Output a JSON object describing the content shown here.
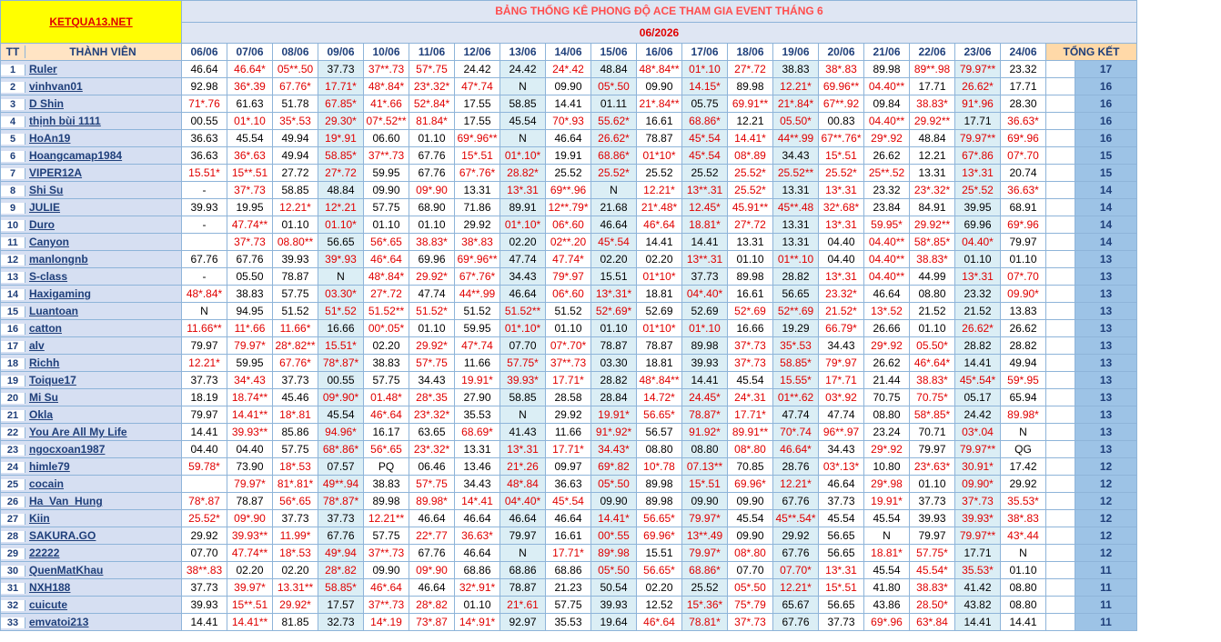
{
  "site_logo": "KETQUA13.NET",
  "table_title": "BẢNG THỐNG KÊ PHONG ĐỘ ACE THAM GIA EVENT THÁNG 6",
  "month": "06/2026",
  "headers": {
    "tt": "TT",
    "member": "THÀNH VIÊN",
    "total": "TỔNG KẾT"
  },
  "dates": [
    "06/06",
    "07/06",
    "08/06",
    "09/06",
    "10/06",
    "11/06",
    "12/06",
    "13/06",
    "14/06",
    "15/06",
    "16/06",
    "17/06",
    "18/06",
    "19/06",
    "20/06",
    "21/06",
    "22/06",
    "23/06",
    "24/06"
  ],
  "rows": [
    {
      "tt": "1",
      "name": "Ruler",
      "total": "17",
      "cells": [
        "46.64",
        "46.64*",
        "05**.50",
        "37.73",
        "37**.73",
        "57*.75",
        "24.42",
        "24.42",
        "24*.42",
        "48.84",
        "48*.84**",
        "01*.10",
        "27*.72",
        "38.83",
        "38*.83",
        "89.98",
        "89**.98",
        "79.97**",
        "23.32"
      ]
    },
    {
      "tt": "2",
      "name": "vinhvan01",
      "total": "16",
      "cells": [
        "92.98",
        "36*.39",
        "67.76*",
        "17.71*",
        "48*.84*",
        "23*.32*",
        "47*.74",
        "N",
        "09.90",
        "05*.50",
        "09.90",
        "14.15*",
        "89.98",
        "12.21*",
        "69.96**",
        "04.40**",
        "17.71",
        "26.62*",
        "17.71"
      ]
    },
    {
      "tt": "3",
      "name": "D Shin",
      "total": "16",
      "cells": [
        "71*.76",
        "61.63",
        "51.78",
        "67.85*",
        "41*.66",
        "52*.84*",
        "17.55",
        "58.85",
        "14.41",
        "01.11",
        "21*.84**",
        "05.75",
        "69.91**",
        "21*.84*",
        "67**.92",
        "09.84",
        "38.83*",
        "91*.96",
        "28.30"
      ]
    },
    {
      "tt": "4",
      "name": "thịnh bùi 1111",
      "total": "16",
      "cells": [
        "00.55",
        "01*.10",
        "35*.53",
        "29.30*",
        "07*.52**",
        "81.84*",
        "17.55",
        "45.54",
        "70*.93",
        "55.62*",
        "16.61",
        "68.86*",
        "12.21",
        "05.50*",
        "00.83",
        "04.40**",
        "29.92**",
        "17.71",
        "36.63*"
      ]
    },
    {
      "tt": "5",
      "name": "HoAn19",
      "total": "16",
      "cells": [
        "36.63",
        "45.54",
        "49.94",
        "19*.91",
        "06.60",
        "01.10",
        "69*.96**",
        "N",
        "46.64",
        "26.62*",
        "78.87",
        "45*.54",
        "14.41*",
        "44**.99",
        "67**.76*",
        "29*.92",
        "48.84",
        "79.97**",
        "69*.96"
      ]
    },
    {
      "tt": "6",
      "name": "Hoangcamap1984",
      "total": "15",
      "cells": [
        "36.63",
        "36*.63",
        "49.94",
        "58.85*",
        "37**.73",
        "67.76",
        "15*.51",
        "01*.10*",
        "19.91",
        "68.86*",
        "01*10*",
        "45*.54",
        "08*.89",
        "34.43",
        "15*.51",
        "26.62",
        "12.21",
        "67*.86",
        "07*.70"
      ]
    },
    {
      "tt": "7",
      "name": "VIPER12A",
      "total": "15",
      "cells": [
        "15.51*",
        "15**.51",
        "27.72",
        "27*.72",
        "59.95",
        "67.76",
        "67*.76*",
        "28.82*",
        "25.52",
        "25.52*",
        "25.52",
        "25.52",
        "25.52*",
        "25.52**",
        "25.52*",
        "25**.52",
        "13.31",
        "13*.31",
        "20.74"
      ]
    },
    {
      "tt": "8",
      "name": "Shi Su",
      "total": "14",
      "cells": [
        "-",
        "37*.73",
        "58.85",
        "48.84",
        "09.90",
        "09*.90",
        "13.31",
        "13*.31",
        "69**.96",
        "N",
        "12.21*",
        "13**.31",
        "25.52*",
        "13.31",
        "13*.31",
        "23.32",
        "23*.32*",
        "25*.52",
        "36.63*"
      ]
    },
    {
      "tt": "9",
      "name": "JULIE",
      "total": "14",
      "cells": [
        "39.93",
        "19.95",
        "12.21*",
        "12*.21",
        "57.75",
        "68.90",
        "71.86",
        "89.91",
        "12**.79*",
        "21.68",
        "21*.48*",
        "12.45*",
        "45.91**",
        "45**.48",
        "32*.68*",
        "23.84",
        "84.91",
        "39.95",
        "68.91"
      ]
    },
    {
      "tt": "10",
      "name": "Duro",
      "total": "14",
      "cells": [
        "-",
        "47.74**",
        "01.10",
        "01.10*",
        "01.10",
        "01.10",
        "29.92",
        "01*.10*",
        "06*.60",
        "46.64",
        "46*.64",
        "18.81*",
        "27*.72",
        "13.31",
        "13*.31",
        "59.95*",
        "29.92**",
        "69.96",
        "69*.96"
      ]
    },
    {
      "tt": "11",
      "name": "Canyon",
      "total": "14",
      "cells": [
        "",
        "37*.73",
        "08.80**",
        "56.65",
        "56*.65",
        "38.83*",
        "38*.83",
        "02.20",
        "02**.20",
        "45*.54",
        "14.41",
        "14.41",
        "13.31",
        "13.31",
        "04.40",
        "04.40**",
        "58*.85*",
        "04.40*",
        "79.97"
      ]
    },
    {
      "tt": "12",
      "name": "manlongnb",
      "total": "13",
      "cells": [
        "67.76",
        "67.76",
        "39.93",
        "39*.93",
        "46*.64",
        "69.96",
        "69*.96**",
        "47.74",
        "47.74*",
        "02.20",
        "02.20",
        "13**.31",
        "01.10",
        "01**.10",
        "04.40",
        "04.40**",
        "38.83*",
        "01.10",
        "01.10"
      ]
    },
    {
      "tt": "13",
      "name": "S-class",
      "total": "13",
      "cells": [
        "-",
        "05.50",
        "78.87",
        "N",
        "48*.84*",
        "29.92*",
        "67*.76*",
        "34.43",
        "79*.97",
        "15.51",
        "01*10*",
        "37.73",
        "89.98",
        "28.82",
        "13*.31",
        "04.40**",
        "44.99",
        "13*.31",
        "07*.70"
      ]
    },
    {
      "tt": "14",
      "name": "Haxigaming",
      "total": "13",
      "cells": [
        "48*.84*",
        "38.83",
        "57.75",
        "03.30*",
        "27*.72",
        "47.74",
        "44**.99",
        "46.64",
        "06*.60",
        "13*.31*",
        "18.81",
        "04*.40*",
        "16.61",
        "56.65",
        "23.32*",
        "46.64",
        "08.80",
        "23.32",
        "09.90*"
      ]
    },
    {
      "tt": "15",
      "name": "Luantoan",
      "total": "13",
      "cells": [
        "N",
        "94.95",
        "51.52",
        "51*.52",
        "51.52**",
        "51.52*",
        "51.52",
        "51.52**",
        "51.52",
        "52*.69*",
        "52.69",
        "52.69",
        "52*.69",
        "52**.69",
        "21.52*",
        "13*.52",
        "21.52",
        "21.52",
        "13.83"
      ]
    },
    {
      "tt": "16",
      "name": "catton",
      "total": "13",
      "cells": [
        "11.66**",
        "11*.66",
        "11.66*",
        "16.66",
        "00*.05*",
        "01.10",
        "59.95",
        "01*.10*",
        "01.10",
        "01.10",
        "01*10*",
        "01*.10",
        "16.66",
        "19.29",
        "66.79*",
        "26.66",
        "01.10",
        "26.62*",
        "26.62"
      ]
    },
    {
      "tt": "17",
      "name": "alv",
      "total": "13",
      "cells": [
        "79.97",
        "79.97*",
        "28*.82**",
        "15.51*",
        "02.20",
        "29.92*",
        "47*.74",
        "07.70",
        "07*.70*",
        "78.87",
        "78.87",
        "89.98",
        "37*.73",
        "35*.53",
        "34.43",
        "29*.92",
        "05.50*",
        "28.82",
        "28.82"
      ]
    },
    {
      "tt": "18",
      "name": "Richh",
      "total": "13",
      "cells": [
        "12.21*",
        "59.95",
        "67.76*",
        "78*.87*",
        "38.83",
        "57*.75",
        "11.66",
        "57.75*",
        "37**.73",
        "03.30",
        "18.81",
        "39.93",
        "37*.73",
        "58.85*",
        "79*.97",
        "26.62",
        "46*.64*",
        "14.41",
        "49.94"
      ]
    },
    {
      "tt": "19",
      "name": "Toique17",
      "total": "13",
      "cells": [
        "37.73",
        "34*.43",
        "37.73",
        "00.55",
        "57.75",
        "34.43",
        "19.91*",
        "39.93*",
        "17.71*",
        "28.82",
        "48*.84**",
        "14.41",
        "45.54",
        "15.55*",
        "17*.71",
        "21.44",
        "38.83*",
        "45*.54*",
        "59*.95"
      ]
    },
    {
      "tt": "20",
      "name": "Mi Su",
      "total": "13",
      "cells": [
        "18.19",
        "18.74**",
        "45.46",
        "09*.90*",
        "01.48*",
        "28*.35",
        "27.90",
        "58.85",
        "28.58",
        "28.84",
        "14.72*",
        "24.45*",
        "24*.31",
        "01**.62",
        "03*.92",
        "70.75",
        "70.75*",
        "05.17",
        "65.94"
      ]
    },
    {
      "tt": "21",
      "name": "Okla",
      "total": "13",
      "cells": [
        "79.97",
        "14.41**",
        "18*.81",
        "45.54",
        "46*.64",
        "23*.32*",
        "35.53",
        "N",
        "29.92",
        "19.91*",
        "56.65*",
        "78.87*",
        "17.71*",
        "47.74",
        "47.74",
        "08.80",
        "58*.85*",
        "24.42",
        "89.98*"
      ]
    },
    {
      "tt": "22",
      "name": "You Are All My Life",
      "total": "13",
      "cells": [
        "14.41",
        "39.93**",
        "85.86",
        "94.96*",
        "16.17",
        "63.65",
        "68.69*",
        "41.43",
        "11.66",
        "91*.92*",
        "56.57",
        "91.92*",
        "89.91**",
        "70*.74",
        "96**.97",
        "23.24",
        "70.71",
        "03*.04",
        "N"
      ]
    },
    {
      "tt": "23",
      "name": "ngocxoan1987",
      "total": "13",
      "cells": [
        "04.40",
        "04.40",
        "57.75",
        "68*.86*",
        "56*.65",
        "23*.32*",
        "13.31",
        "13*.31",
        "17.71*",
        "34.43*",
        "08.80",
        "08.80",
        "08*.80",
        "46.64*",
        "34.43",
        "29*.92",
        "79.97",
        "79.97**",
        "QG"
      ]
    },
    {
      "tt": "24",
      "name": "himle79",
      "total": "12",
      "cells": [
        "59.78*",
        "73.90",
        "18*.53",
        "07.57",
        "PQ",
        "06.46",
        "13.46",
        "21*.26",
        "09.97",
        "69*.82",
        "10*.78",
        "07.13**",
        "70.85",
        "28.76",
        "03*.13*",
        "10.80",
        "23*.63*",
        "30.91*",
        "17.42"
      ]
    },
    {
      "tt": "25",
      "name": "cocain",
      "total": "12",
      "cells": [
        "",
        "79.97*",
        "81*.81*",
        "49**.94",
        "38.83",
        "57*.75",
        "34.43",
        "48*.84",
        "36.63",
        "05*.50",
        "89.98",
        "15*.51",
        "69.96*",
        "12.21*",
        "46.64",
        "29*.98",
        "01.10",
        "09.90*",
        "29.92"
      ]
    },
    {
      "tt": "26",
      "name": "Ha_Van_Hung",
      "total": "12",
      "cells": [
        "78*.87",
        "78.87",
        "56*.65",
        "78*.87*",
        "89.98",
        "89.98*",
        "14*.41",
        "04*.40*",
        "45*.54",
        "09.90",
        "89.98",
        "09.90",
        "09.90",
        "67.76",
        "37.73",
        "19.91*",
        "37.73",
        "37*.73",
        "35.53*"
      ]
    },
    {
      "tt": "27",
      "name": "Kiin",
      "total": "12",
      "cells": [
        "25.52*",
        "09*.90",
        "37.73",
        "37.73",
        "12.21**",
        "46.64",
        "46.64",
        "46.64",
        "46.64",
        "14.41*",
        "56.65*",
        "79.97*",
        "45.54",
        "45**.54*",
        "45.54",
        "45.54",
        "39.93",
        "39.93*",
        "38*.83"
      ]
    },
    {
      "tt": "28",
      "name": "SAKURA.GO",
      "total": "12",
      "cells": [
        "29.92",
        "39.93**",
        "11.99*",
        "67.76",
        "57.75",
        "22*.77",
        "36.63*",
        "79.97",
        "16.61",
        "00*.55",
        "69.96*",
        "13**.49",
        "09.90",
        "29.92",
        "56.65",
        "N",
        "79.97",
        "79.97**",
        "43*.44"
      ]
    },
    {
      "tt": "29",
      "name": "22222",
      "total": "12",
      "cells": [
        "07.70",
        "47.74**",
        "18*.53",
        "49*.94",
        "37**.73",
        "67.76",
        "46.64",
        "N",
        "17.71*",
        "89*.98",
        "15.51",
        "79.97*",
        "08*.80",
        "67.76",
        "56.65",
        "18.81*",
        "57.75*",
        "17.71",
        "N"
      ]
    },
    {
      "tt": "30",
      "name": "QuenMatKhau",
      "total": "11",
      "cells": [
        "38**.83",
        "02.20",
        "02.20",
        "28*.82",
        "09.90",
        "09*.90",
        "68.86",
        "68.86",
        "68.86",
        "05*.50",
        "56.65*",
        "68.86*",
        "07.70",
        "07.70*",
        "13*.31",
        "45.54",
        "45.54*",
        "35.53*",
        "01.10"
      ]
    },
    {
      "tt": "31",
      "name": "NXH188",
      "total": "11",
      "cells": [
        "37.73",
        "39.97*",
        "13.31**",
        "58.85*",
        "46*.64",
        "46.64",
        "32*.91*",
        "78.87",
        "21.23",
        "50.54",
        "02.20",
        "25.52",
        "05*.50",
        "12.21*",
        "15*.51",
        "41.80",
        "38.83*",
        "41.42",
        "08.80"
      ]
    },
    {
      "tt": "32",
      "name": "cuicute",
      "total": "11",
      "cells": [
        "39.93",
        "15**.51",
        "29.92*",
        "17.57",
        "37**.73",
        "28*.82",
        "01.10",
        "21*.61",
        "57.75",
        "39.93",
        "12.52",
        "15*.36*",
        "75*.79",
        "65.67",
        "56.65",
        "43.86",
        "28.50*",
        "43.82",
        "08.80"
      ]
    },
    {
      "tt": "33",
      "name": "emvatoi213",
      "total": "11",
      "cells": [
        "14.41",
        "14.41**",
        "81.85",
        "32.73",
        "14*.19",
        "73*.87",
        "14*.91*",
        "92.97",
        "35.53",
        "19.64",
        "46*.64",
        "78.81*",
        "37*.73",
        "67.76",
        "37.73",
        "69*.96",
        "63*.84",
        "14.41",
        "14.41"
      ]
    }
  ]
}
